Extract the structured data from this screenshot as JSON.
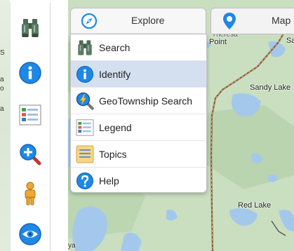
{
  "left_strip": {
    "labels": [
      "S",
      "a",
      "o",
      "a"
    ]
  },
  "toolbar": {
    "items": [
      {
        "name": "binoculars-icon"
      },
      {
        "name": "info-icon"
      },
      {
        "name": "legend-icon"
      },
      {
        "name": "zoom-icon"
      },
      {
        "name": "person-icon"
      },
      {
        "name": "eye-icon"
      }
    ]
  },
  "tabs": {
    "explore": {
      "label": "Explore",
      "icon": "compass-icon"
    },
    "map": {
      "label": "Map",
      "icon": "location-pin-icon"
    }
  },
  "menu": {
    "items": [
      {
        "label": "Search",
        "icon": "binoculars-icon",
        "active": false
      },
      {
        "label": "Identify",
        "icon": "info-icon",
        "active": true
      },
      {
        "label": "GeoTownship Search",
        "icon": "geotownship-icon",
        "active": false
      },
      {
        "label": "Legend",
        "icon": "legend-icon",
        "active": false
      },
      {
        "label": "Topics",
        "icon": "topics-icon",
        "active": false
      },
      {
        "label": "Help",
        "icon": "help-icon",
        "active": false
      }
    ]
  },
  "map": {
    "labels": {
      "point_top": "Theresa",
      "point": "Point",
      "sandy_lake": "Sandy Lake",
      "red_lake": "Red Lake",
      "sa": "Sa",
      "ya": "ya"
    }
  },
  "colors": {
    "accent_blue": "#1e88e5",
    "active_row": "#d4dfef",
    "map_land": "#c9dfc0",
    "map_water": "#a4c8ec",
    "road": "#8b5a3c"
  }
}
